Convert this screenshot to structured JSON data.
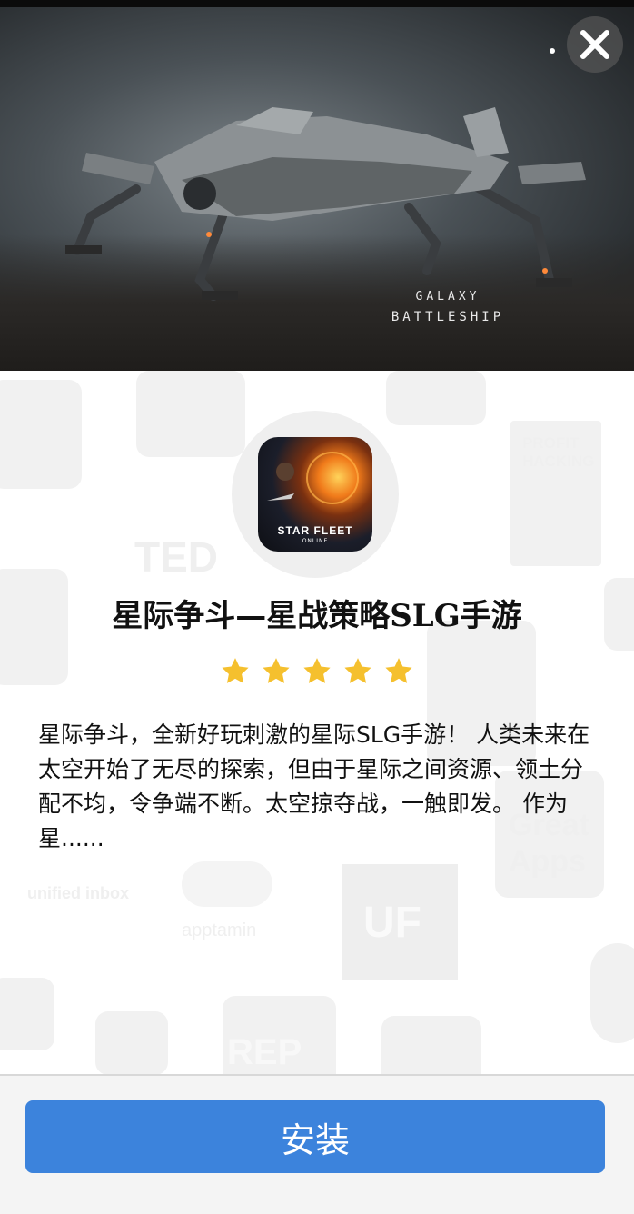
{
  "hero": {
    "brand_line1": "GALAXY",
    "brand_line2": "BATTLESHIP"
  },
  "app": {
    "icon_text": "STAR FLEET",
    "icon_subtext": "ONLINE",
    "title": "星际争斗—星战策略SLG手游",
    "rating": 5,
    "description": "星际争斗，全新好玩刺激的星际SLG手游！ 人类未来在太空开始了无尽的探索，但由于星际之间资源、领土分配不均，令争端不断。太空掠夺战，一触即发。 作为星......"
  },
  "background": {
    "texts": [
      "TED",
      "apptamin",
      "unified inbox",
      "PROFIT HACKING",
      "Great Apps",
      "UF",
      "REP"
    ]
  },
  "install": {
    "label": "安装"
  },
  "colors": {
    "accent": "#3c83dc",
    "star": "#f5c02e"
  }
}
